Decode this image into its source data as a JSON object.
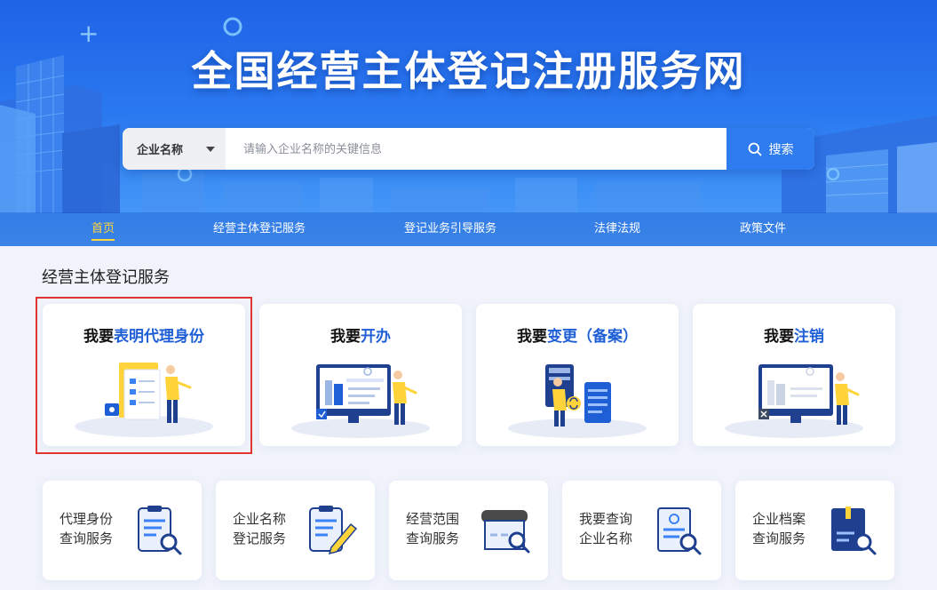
{
  "header": {
    "title": "全国经营主体登记注册服务网",
    "search": {
      "select_value": "企业名称",
      "placeholder": "请输入企业名称的关键信息",
      "button_label": "搜索"
    },
    "nav": [
      {
        "label": "首页",
        "active": true
      },
      {
        "label": "经营主体登记服务",
        "active": false
      },
      {
        "label": "登记业务引导服务",
        "active": false
      },
      {
        "label": "法律法规",
        "active": false
      },
      {
        "label": "政策文件",
        "active": false
      }
    ]
  },
  "main": {
    "section_title": "经营主体登记服务",
    "cards": [
      {
        "prefix": "我要",
        "highlight": "表明代理身份",
        "icon": "agent-identity-illustration",
        "selected": true
      },
      {
        "prefix": "我要",
        "highlight": "开办",
        "icon": "open-business-illustration",
        "selected": false
      },
      {
        "prefix": "我要",
        "highlight": "变更（备案）",
        "icon": "change-filing-illustration",
        "selected": false
      },
      {
        "prefix": "我要",
        "highlight": "注销",
        "icon": "cancel-business-illustration",
        "selected": false
      }
    ],
    "services": [
      {
        "line1": "代理身份",
        "line2": "查询服务",
        "icon": "clipboard-search-icon"
      },
      {
        "line1": "企业名称",
        "line2": "登记服务",
        "icon": "clipboard-pen-icon"
      },
      {
        "line1": "经营范围",
        "line2": "查询服务",
        "icon": "shop-search-icon"
      },
      {
        "line1": "我要查询",
        "line2": "企业名称",
        "icon": "certificate-search-icon"
      },
      {
        "line1": "企业档案",
        "line2": "查询服务",
        "icon": "archive-search-icon"
      }
    ]
  },
  "colors": {
    "accent": "#1f5fd6",
    "banner": "#2a78f0",
    "nav_active": "#ffd43a",
    "selection_border": "#e33434"
  }
}
